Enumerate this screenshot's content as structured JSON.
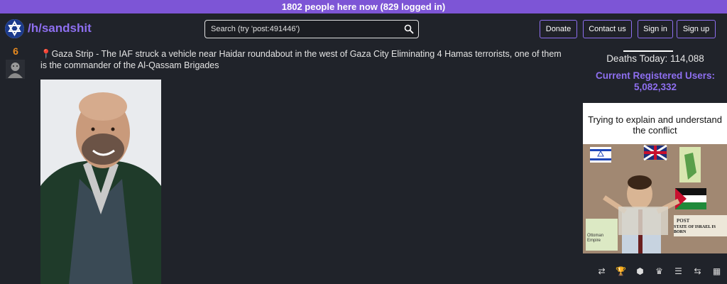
{
  "banner": {
    "text": "1802 people here now (829 logged in)"
  },
  "header": {
    "sub_name": "/h/sandshit",
    "search_placeholder": "Search (try 'post:491446')",
    "buttons": {
      "donate": "Donate",
      "contact": "Contact us",
      "signin": "Sign in",
      "signup": "Sign up"
    }
  },
  "post": {
    "score": "6",
    "title": "Gaza Strip - The IAF struck a vehicle near Haidar roundabout in the west of Gaza City Eliminating 4 Hamas terrorists, one of them is the commander of the Al-Qassam Brigades"
  },
  "sidebar": {
    "deaths": "Deaths Today: 114,088",
    "registered_label": "Current Registered Users:",
    "registered_value": "5,082,332"
  },
  "meme": {
    "caption": "Trying to explain and understand the conflict",
    "texts": {
      "state": "STATE OF ISRAEL IS BORN",
      "post": "POST",
      "ottoman": "Ottoman Empire"
    }
  },
  "footer_icons": [
    "shuffle-icon",
    "trophy-icon",
    "hexagon-icon",
    "crown-icon",
    "scroll-icon",
    "exchange-icon",
    "chart-icon"
  ],
  "colors": {
    "accent": "#8e6ff0",
    "banner": "#7d55d6",
    "background": "#20232a",
    "score": "#e98b1f"
  }
}
